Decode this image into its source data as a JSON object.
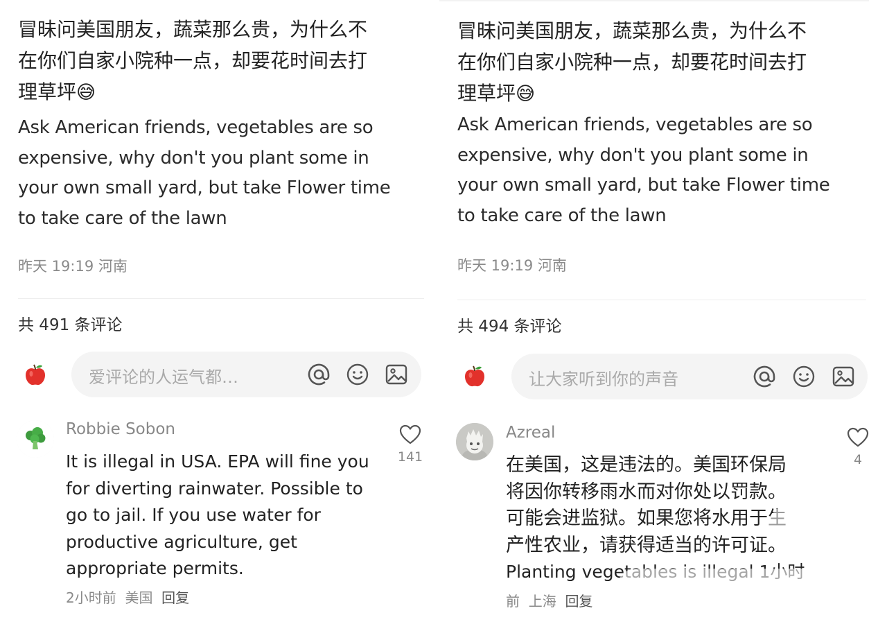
{
  "left": {
    "post_cn_lines": [
      "冒昧问美国朋友，蔬菜那么贵，为什么不",
      "在你们自家小院种一点，却要花时间去打",
      "理草坪"
    ],
    "post_emoji": "😅",
    "post_en_lines": [
      "Ask American friends, vegetables are so",
      "expensive, why don't you plant some in",
      "your own small yard, but take Flower time",
      "to take care of the lawn"
    ],
    "meta": "昨天 19:19 河南",
    "comment_count": "共 491 条评论",
    "input_placeholder": "爱评论的人运气都…",
    "comment": {
      "author": "Robbie Sobon",
      "body_lines": [
        "It is illegal in USA. EPA will fine you",
        "for diverting rainwater. Possible to",
        "go to jail. If you use water for",
        "productive agriculture, get",
        "appropriate permits."
      ],
      "time": "2小时前",
      "location": "美国",
      "reply": "回复",
      "likes": "141"
    }
  },
  "right": {
    "post_cn_lines": [
      "冒昧问美国朋友，蔬菜那么贵，为什么不",
      "在你们自家小院种一点，却要花时间去打",
      "理草坪"
    ],
    "post_emoji": "😅",
    "post_en_lines": [
      "Ask American friends, vegetables are so",
      "expensive, why don't you plant some in",
      "your own small yard, but take Flower time",
      "to take care of the lawn"
    ],
    "meta": "昨天 19:19 河南",
    "comment_count": "共 494 条评论",
    "input_placeholder": "让大家听到你的声音",
    "comment": {
      "author": "Azreal",
      "body_lines": [
        "在美国，这是违法的。美国环保局",
        "将因你转移雨水而对你处以罚款。",
        "可能会进监狱。如果您将水用于生",
        "产性农业，请获得适当的许可证。",
        "Planting vegetables is illegal 1小时"
      ],
      "time": "前",
      "location": "上海",
      "reply": "回复",
      "likes": "4"
    }
  },
  "icons": {
    "mention": "at-icon",
    "emoji": "smiley-icon",
    "image": "image-icon",
    "like": "heart-icon",
    "user_avatar": "apple-icon",
    "commenter_left": "broccoli-icon",
    "commenter_right": "figurine-avatar"
  },
  "colors": {
    "meta_gray": "#8a8a8a",
    "input_bg": "#f4f4f4",
    "apple_red": "#e2312b"
  }
}
